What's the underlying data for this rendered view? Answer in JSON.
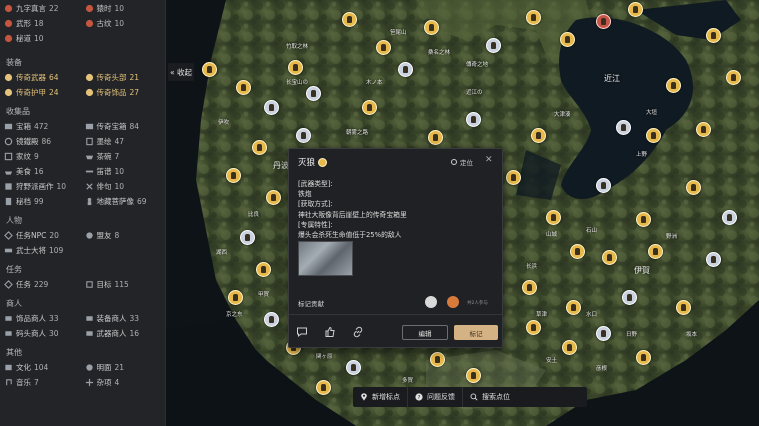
{
  "sidebar": {
    "top_items": [
      {
        "label": "九字真言",
        "count": "22",
        "icon": "seal-icon"
      },
      {
        "label": "猿时",
        "count": "10",
        "icon": "monkey-icon"
      },
      {
        "label": "武形",
        "count": "18",
        "icon": "fist-icon"
      },
      {
        "label": "古纹",
        "count": "10",
        "icon": "pattern-icon"
      },
      {
        "label": "秘道",
        "count": "10",
        "icon": "path-icon"
      }
    ],
    "sections": [
      {
        "title": "装备",
        "items": [
          {
            "label": "传奇武器",
            "count": "64",
            "icon": "sword-icon",
            "gold": true
          },
          {
            "label": "传奇头部",
            "count": "21",
            "icon": "helmet-icon",
            "gold": true
          },
          {
            "label": "传奇护甲",
            "count": "24",
            "icon": "armor-icon",
            "gold": true
          },
          {
            "label": "传奇饰品",
            "count": "27",
            "icon": "charm-icon",
            "gold": true
          }
        ]
      },
      {
        "title": "收集品",
        "items": [
          {
            "label": "宝箱",
            "count": "472",
            "icon": "chest-icon"
          },
          {
            "label": "传奇宝箱",
            "count": "84",
            "icon": "legend-chest-icon"
          },
          {
            "label": "镜鐵殿",
            "count": "86",
            "icon": "mirror-icon"
          },
          {
            "label": "墨绘",
            "count": "47",
            "icon": "ink-icon"
          },
          {
            "label": "家纹",
            "count": "9",
            "icon": "crest-icon"
          },
          {
            "label": "茶碗",
            "count": "7",
            "icon": "teabowl-icon"
          },
          {
            "label": "美食",
            "count": "16",
            "icon": "food-icon"
          },
          {
            "label": "笛谱",
            "count": "10",
            "icon": "flute-icon"
          },
          {
            "label": "狩野派画作",
            "count": "10",
            "icon": "painting-icon"
          },
          {
            "label": "俳句",
            "count": "10",
            "icon": "haiku-icon"
          },
          {
            "label": "秘档",
            "count": "99",
            "icon": "document-icon"
          },
          {
            "label": "地藏菩萨像",
            "count": "69",
            "icon": "statue-icon"
          }
        ]
      },
      {
        "title": "人物",
        "items": [
          {
            "label": "任务NPC",
            "count": "20",
            "icon": "npc-icon"
          },
          {
            "label": "盟友",
            "count": "8",
            "icon": "ally-icon"
          },
          {
            "label": "武士大将",
            "count": "109",
            "icon": "samurai-icon"
          }
        ]
      },
      {
        "title": "任务",
        "items": [
          {
            "label": "任务",
            "count": "229",
            "icon": "quest-icon"
          },
          {
            "label": "目标",
            "count": "115",
            "icon": "target-icon"
          }
        ]
      },
      {
        "title": "商人",
        "items": [
          {
            "label": "饰品商人",
            "count": "33",
            "icon": "accessory-merchant-icon"
          },
          {
            "label": "装备商人",
            "count": "33",
            "icon": "gear-merchant-icon"
          },
          {
            "label": "码头商人",
            "count": "30",
            "icon": "dock-merchant-icon"
          },
          {
            "label": "武器商人",
            "count": "16",
            "icon": "weapon-merchant-icon"
          }
        ]
      },
      {
        "title": "其他",
        "items": [
          {
            "label": "文化",
            "count": "104",
            "icon": "culture-icon"
          },
          {
            "label": "明面",
            "count": "21",
            "icon": "mask-icon"
          },
          {
            "label": "音乐",
            "count": "7",
            "icon": "music-icon"
          },
          {
            "label": "杂项",
            "count": "4",
            "icon": "misc-icon"
          }
        ]
      }
    ]
  },
  "collapse_label": "« 收起",
  "map": {
    "places": [
      "近江",
      "丹波",
      "伊賀"
    ],
    "labels": [
      "丹波",
      "近江の",
      "笹尾山",
      "傳奇之地",
      "长宝山の",
      "桑名之林",
      "大津湊",
      "竹取之林",
      "朝雾之路",
      "木ノ本",
      "伊吹",
      "比良",
      "湖西",
      "甲賀",
      "京之东",
      "山城",
      "长浜",
      "石山",
      "野洲",
      "草津",
      "水口",
      "日野",
      "坂本",
      "安土",
      "彦根",
      "多賀",
      "醒井",
      "関ヶ原",
      "大垣",
      "上野"
    ]
  },
  "popup": {
    "title": "灭狼",
    "locate_label": "定位",
    "close_symbol": "✕",
    "body_lines": [
      "[武器类型]:",
      "铁炮",
      "[获取方式]:",
      "神社大阪像背后崖壁上的传奇宝箱里",
      "[专属特性]:",
      "爆头会杀死生命值低于25%的敌人"
    ],
    "contributors_label": "标记贡献",
    "marked_count": "共2人参与",
    "edit_label": "编辑",
    "mark_label": "标记"
  },
  "bottombar": {
    "add_point": "新增标点",
    "feedback": "问题反馈",
    "search_placeholder": "搜索点位"
  },
  "colors": {
    "accent_gold": "#e4c27a",
    "mark_button": "#d5b283",
    "sidebar_bg": "#232428"
  }
}
